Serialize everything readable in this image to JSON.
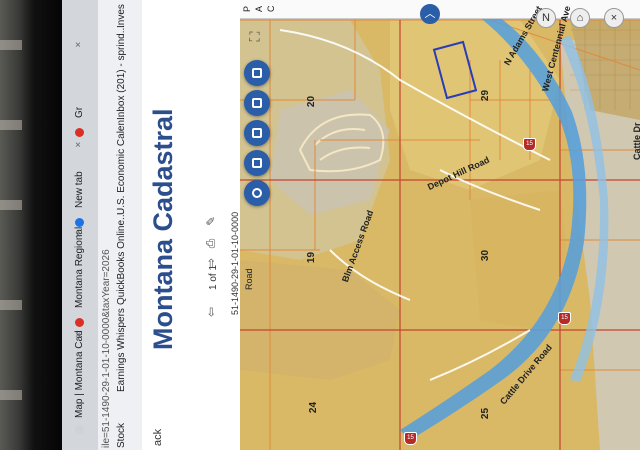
{
  "browser": {
    "tabs": [
      {
        "label": "Map | Montana Cad",
        "close": "×"
      },
      {
        "label": "Montana Regional",
        "close": "×"
      },
      {
        "label": "New tab",
        "close": "×"
      },
      {
        "label": "Gr",
        "close": "×"
      }
    ],
    "url_fragment": "ile=51-1490-29-1-01-10-0000&taxYear=2026",
    "bookmarks": [
      {
        "label": "Earnings Whispers"
      },
      {
        "label": "QuickBooks Online..."
      },
      {
        "label": "U.S. Economic Calen..."
      },
      {
        "label": "Inbox (201) - sprind..."
      },
      {
        "label": "Inves"
      }
    ],
    "bookmark_partial": "Stock"
  },
  "panel": {
    "title": "Montana Cadastral",
    "back_label": "ack",
    "pager": "1 of 1",
    "parcel_id": "51-1490-29-1-01-10-0000"
  },
  "map": {
    "top_letters": [
      "P",
      "A",
      "C"
    ],
    "sections": [
      "20",
      "29",
      "19",
      "30",
      "24",
      "25"
    ],
    "roads": {
      "depot_hill": "Depot Hill Road",
      "blm_access": "Blm Access Road",
      "cattle_drive": "Cattle Drive Road",
      "cattle_drive_2": "Cattle Dr",
      "adams": "N Adams Street",
      "centennial": "West Centennial Ave",
      "rd": "Road"
    },
    "interstate": "15",
    "compass": "N"
  },
  "colors": {
    "terrain": "#d9b966",
    "river": "#5aa0d8",
    "parcel_line": "#e08a3c",
    "section_line": "#c4442f",
    "accent": "#2a5ea8"
  }
}
